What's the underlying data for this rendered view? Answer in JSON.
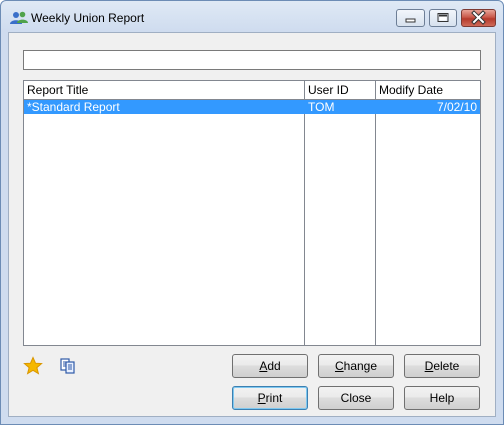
{
  "window": {
    "title": "Weekly Union Report"
  },
  "filter": {
    "value": ""
  },
  "list": {
    "columns": [
      "Report Title",
      "User ID",
      "Modify Date"
    ],
    "rows": [
      {
        "title": "*Standard Report",
        "user_id": "TOM",
        "modify_date": "7/02/10",
        "selected": true
      }
    ]
  },
  "buttons": {
    "add": {
      "pre": "",
      "mn": "A",
      "post": "dd"
    },
    "change": {
      "pre": "",
      "mn": "C",
      "post": "hange"
    },
    "delete": {
      "pre": "",
      "mn": "D",
      "post": "elete"
    },
    "print": {
      "pre": "",
      "mn": "P",
      "post": "rint"
    },
    "close": "Close",
    "help": "Help"
  },
  "icons": {
    "title": "users-icon",
    "favorite": "star-icon",
    "copy": "copy-icon",
    "minimize": "minimize-icon",
    "maximize": "maximize-icon",
    "close": "close-icon"
  },
  "colors": {
    "selection": "#3399ff",
    "close_button": "#c9584a",
    "star": "#f5b800"
  }
}
